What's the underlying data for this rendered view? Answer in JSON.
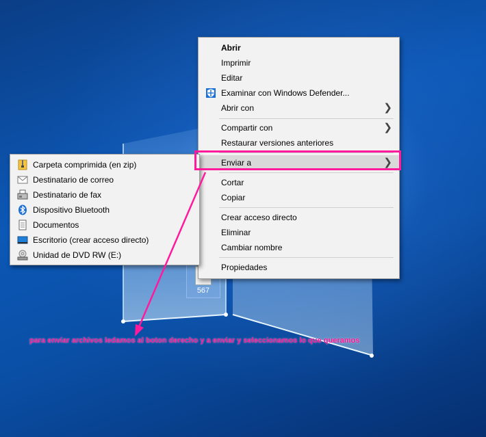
{
  "desktop": {
    "icon_name": "567"
  },
  "context_menu": {
    "items": [
      {
        "label": "Abrir"
      },
      {
        "label": "Imprimir"
      },
      {
        "label": "Editar"
      },
      {
        "label": "Examinar con Windows Defender..."
      },
      {
        "label": "Abrir con"
      },
      {
        "label": "Compartir con"
      },
      {
        "label": "Restaurar versiones anteriores"
      },
      {
        "label": "Enviar a"
      },
      {
        "label": "Cortar"
      },
      {
        "label": "Copiar"
      },
      {
        "label": "Crear acceso directo"
      },
      {
        "label": "Eliminar"
      },
      {
        "label": "Cambiar nombre"
      },
      {
        "label": "Propiedades"
      }
    ]
  },
  "send_to_menu": {
    "items": [
      {
        "label": "Carpeta comprimida (en zip)",
        "icon": "zip-folder-icon"
      },
      {
        "label": "Destinatario de correo",
        "icon": "mail-icon"
      },
      {
        "label": "Destinatario de fax",
        "icon": "fax-icon"
      },
      {
        "label": "Dispositivo Bluetooth",
        "icon": "bluetooth-icon"
      },
      {
        "label": "Documentos",
        "icon": "documents-icon"
      },
      {
        "label": "Escritorio (crear acceso directo)",
        "icon": "desktop-icon"
      },
      {
        "label": "Unidad de DVD RW (E:)",
        "icon": "dvd-drive-icon"
      }
    ]
  },
  "annotation": {
    "text": "para enviar archivos ledamos al boton derecho y a enviar y seleccionamos lo que queramos",
    "color": "#ff1493"
  }
}
